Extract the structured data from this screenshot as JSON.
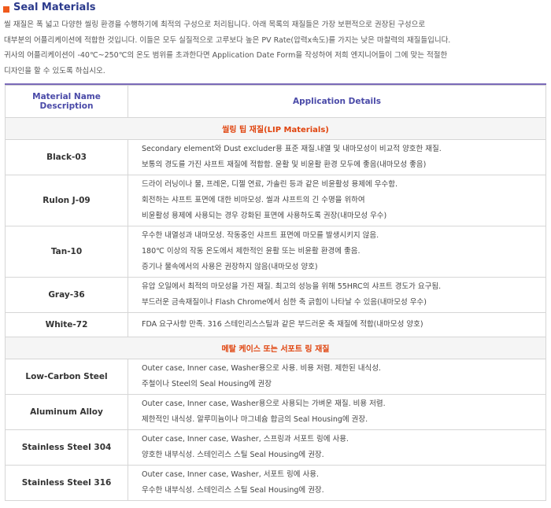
{
  "title": "Seal Materials",
  "intro": [
    "씰 재질은 폭 넓고 다양한 씰링 환경을 수행하기에 최적의 구성으로 처리됩니다. 아래 목록의 재질들은 가장 보편적으로 권장된 구성으로",
    "대부분의 어플리케이션에 적합한 것입니다. 이들은 모두 실질적으로 고루보다 높은 PV Rate(압력x속도)를 가지는 낮은 마찰력의 재질들입니다.",
    "귀사의 어플리케이션이 -40℃~250℃의 온도 범위를 초과한다면 Application Date Form을 작성하여 저희 엔지니어들이 그에 맞는 적절한",
    "디자인을 할 수 있도록 하십시오."
  ],
  "table": {
    "headers": [
      "Material Name Description",
      "Application Details"
    ],
    "sections": [
      {
        "title": "씰링 팁 재질(LIP Materials)",
        "rows": [
          {
            "name": "Black-03",
            "lines": [
              "Secondary element와 Dust excluder용 표준 재질.내열 및 내마모성이 비교적 양호한 재질.",
              "보통의 경도를 가진 샤프트 재질에 적합함. 윤활 및 비윤활 환경 모두에 좋음(내마모성 좋음)"
            ]
          },
          {
            "name": "Rulon J-09",
            "lines": [
              "드라이 러닝이나 물, 프레온, 디젤 연료, 가솔린 등과 같은 비윤활성 용제에 우수함.",
              "회전하는 샤프트 표면에 대한 비마모성. 씰과 샤프트의 긴 수명을 위하여",
              "비윤활성 용제에 사용되는 경우 강화된 표면에 사용하도록 권장(내마모성 우수)"
            ]
          },
          {
            "name": "Tan-10",
            "lines": [
              "우수한 내열성과 내마모성. 작동중인 샤프트 표면에 마모를 발생시키지 않음.",
              "180℃ 이상의 작동 온도에서 제한적인 윤활 또는 비윤활 환경에 좋음.",
              "증기나 물속에서의 사용은 권장하지 않음(내마모성 양호)"
            ]
          },
          {
            "name": "Gray-36",
            "lines": [
              "유압 오일에서 최적의 마모성을 가진 재질. 최고의 성능을 위해 55HRC의 샤프트 경도가 요구됨.",
              "부드러운 금속재질이나 Flash Chrome에서 심한 축 긁힘이 나타날 수 있음(내마모성 우수)"
            ]
          },
          {
            "name": "White-72",
            "lines": [
              "FDA 요구사항 만족. 316 스테인리스스틸과 같은 부드러운 축 재질에 적합(내마모성 양호)"
            ]
          }
        ]
      },
      {
        "title": "메탈 케이스 또는 서포트 링 재질",
        "rows": [
          {
            "name": "Low-Carbon Steel",
            "lines": [
              "Outer case, Inner case, Washer용으로 사용. 비용 저렴. 제한된 내식성.",
              "주철이나 Steel의 Seal Housing에 권장"
            ]
          },
          {
            "name": "Aluminum Alloy",
            "lines": [
              "Outer case, Inner case, Washer용으로 사용되는 가벼운 재질. 비용 저렴.",
              "제한적인 내식성. 알루미늄이나 마그네슘 합금의 Seal Housing에 권장."
            ]
          },
          {
            "name": "Stainless Steel 304",
            "lines": [
              "Outer case, Inner case, Washer, 스프링과 서포트 링에 사용.",
              "양호한 내부식성. 스테인리스 스틸 Seal Housing에 권장."
            ]
          },
          {
            "name": "Stainless Steel 316",
            "lines": [
              "Outer case, Inner case, Washer, 서포트 링에 사용.",
              "우수한 내부식성. 스테인리스 스틸 Seal Housing에 권장."
            ]
          }
        ]
      }
    ]
  }
}
